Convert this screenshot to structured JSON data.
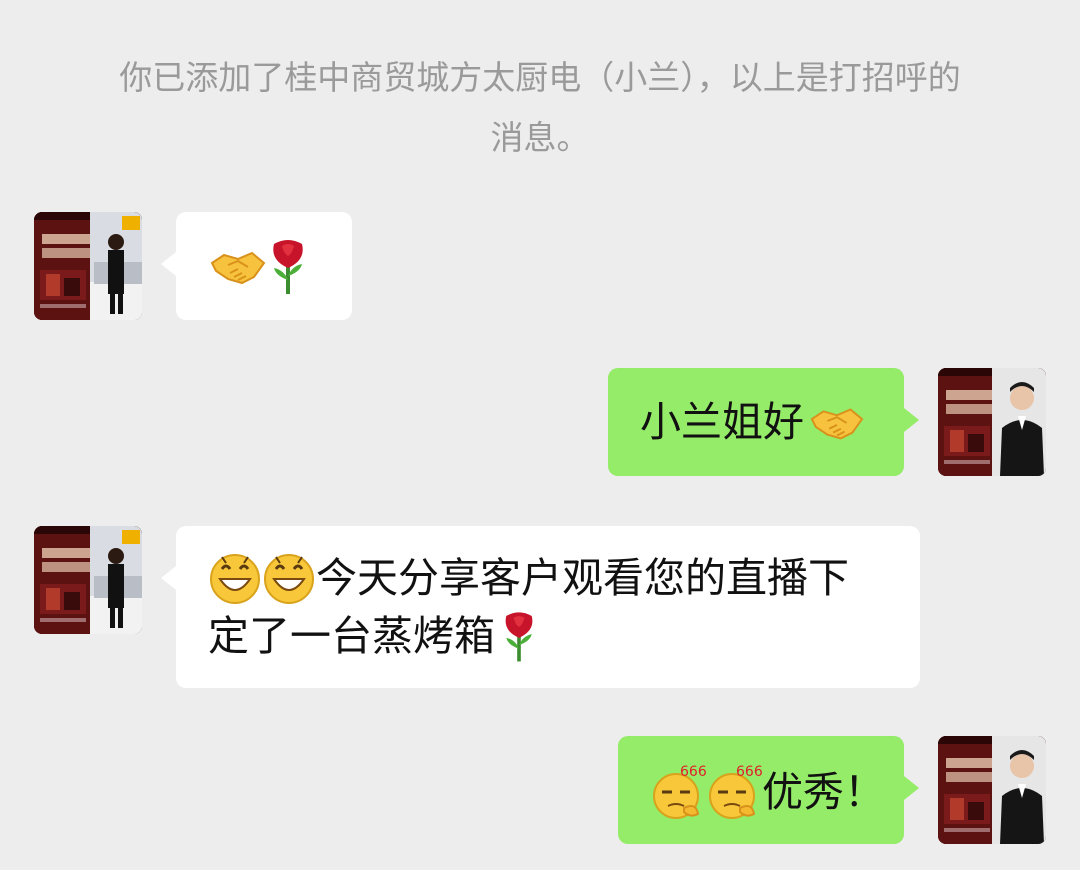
{
  "system": {
    "notice_line1": "你已添加了桂中商贸城方太厨电（小兰），以上是打招呼的",
    "notice_line2": "消息。"
  },
  "messages": [
    {
      "sender": "contact",
      "avatar": "contact-avatar",
      "emojis": [
        "handshake-icon",
        "rose-icon"
      ]
    },
    {
      "sender": "self",
      "avatar": "self-avatar",
      "text": "小兰姐好",
      "emojis": [
        "handshake-icon"
      ]
    },
    {
      "sender": "contact",
      "avatar": "contact-avatar",
      "line1": "今天分享客户观看您的直播下",
      "line2": "定了一台蒸烤箱",
      "emojis": [
        "grin-icon",
        "grin-icon",
        "rose-icon"
      ]
    },
    {
      "sender": "self",
      "avatar": "self-avatar",
      "text": "优秀！",
      "emoji_caption": "666",
      "emojis": [
        "666-icon",
        "666-icon"
      ]
    }
  ],
  "colors": {
    "background": "#ededed",
    "incoming_bubble": "#ffffff",
    "outgoing_bubble": "#95ec69",
    "system_text": "#9a9a9a"
  }
}
